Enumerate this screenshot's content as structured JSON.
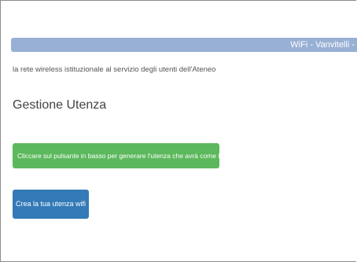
{
  "header": {
    "title": "WiFi - Vanvitelli -"
  },
  "intro": {
    "subtitle": "la rete wireless istituzionale al servizio degli utenti dell'Ateneo"
  },
  "section": {
    "title": "Gestione Utenza"
  },
  "alert": {
    "text": "Cliccare sul pulsante in basso per generare l'utenza che avrà come login"
  },
  "actions": {
    "create_label": "Crea la tua utenza wifi"
  },
  "colors": {
    "header_bar": "#98b0d4",
    "alert_success": "#5cb85c",
    "primary_button": "#337ab7"
  }
}
